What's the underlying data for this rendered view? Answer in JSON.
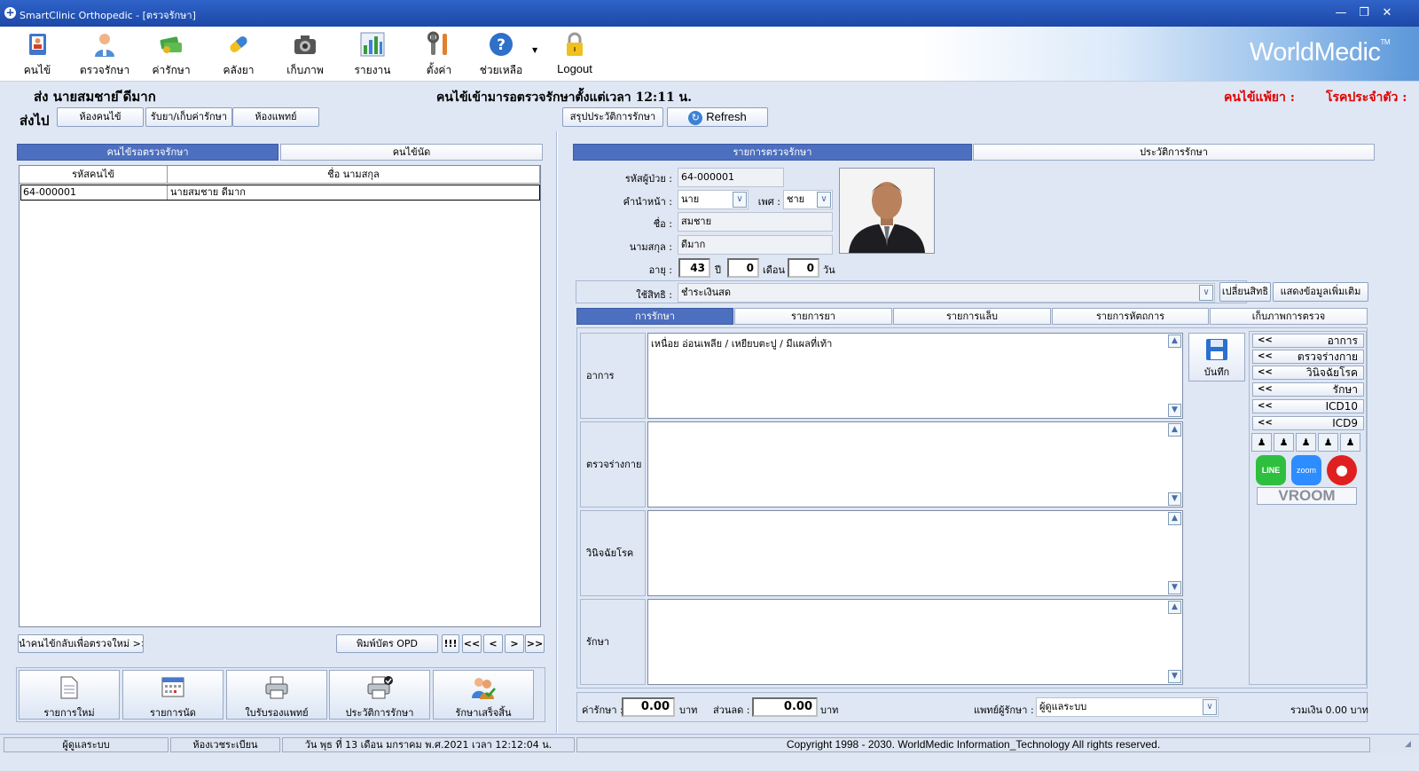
{
  "window": {
    "title": "SmartClinic Orthopedic - [ตรวจรักษา]"
  },
  "toolbar": {
    "items": [
      {
        "label": "คนไข้",
        "icon": "patient-book-icon"
      },
      {
        "label": "ตรวจรักษา",
        "icon": "doctor-icon"
      },
      {
        "label": "ค่ารักษา",
        "icon": "money-icon"
      },
      {
        "label": "คลังยา",
        "icon": "capsule-icon"
      },
      {
        "label": "เก็บภาพ",
        "icon": "camera-icon"
      },
      {
        "label": "รายงาน",
        "icon": "bar-chart-icon"
      },
      {
        "label": "ตั้งค่า",
        "icon": "tools-icon"
      },
      {
        "label": "ช่วยเหลือ",
        "icon": "help-icon"
      },
      {
        "label": "Logout",
        "icon": "lock-icon"
      }
    ],
    "brand": "WorldMedic",
    "brand_tm": "TM"
  },
  "header": {
    "send_name": "ส่ง  นายสมชาย ีดีมาก",
    "wait_message": "คนไข้เข้ามารอตรวจรักษาตั้งแต่เวลา 12:11 น.",
    "allergy_label": "คนไข้แพ้ยา :",
    "chronic_label": "โรคประจำตัว :"
  },
  "sendto": {
    "label": "ส่งไป",
    "buttons": [
      "ห้องคนไข้",
      "รับยา/เก็บค่ารักษา",
      "ห้องแพทย์"
    ],
    "summary_button": "สรุปประวัติการรักษา",
    "refresh_button": "Refresh"
  },
  "left": {
    "tabs": [
      "คนไข้รอตรวจรักษา",
      "คนไข้นัด"
    ],
    "columns": [
      "รหัสคนไข้",
      "ชื่อ นามสกุล"
    ],
    "rows": [
      {
        "id": "64-000001",
        "name": "นายสมชาย ดีมาก"
      }
    ],
    "return_button": "นำคนไข้กลับเพื่อตรวจใหม่ >>",
    "print_button": "พิมพ์บัตร OPD",
    "nav": [
      "!!!",
      "<<",
      "<",
      ">",
      ">>"
    ],
    "big_buttons": [
      {
        "label": "รายการใหม่",
        "icon": "document-icon"
      },
      {
        "label": "รายการนัด",
        "icon": "calendar-icon"
      },
      {
        "label": "ใบรับรองแพทย์",
        "icon": "printer-icon"
      },
      {
        "label": "ประวัติการรักษา",
        "icon": "printer-check-icon"
      },
      {
        "label": "รักษาเสร็จสิ้น",
        "icon": "users-check-icon"
      }
    ]
  },
  "right": {
    "tabs": [
      "รายการตรวจรักษา",
      "ประวัติการรักษา"
    ],
    "patient": {
      "id_label": "รหัสผู้ป่วย :",
      "id": "64-000001",
      "prefix_label": "คำนำหน้า :",
      "prefix": "นาย",
      "sex_label": "เพศ :",
      "sex": "ชาย",
      "first_label": "ชื่อ :",
      "first": "สมชาย",
      "last_label": "นามสกุล :",
      "last": "ดีมาก",
      "age_label": "อายุ :",
      "age_years": "43",
      "years_unit": "ปี",
      "age_months": "0",
      "months_unit": "เดือน",
      "age_days": "0",
      "days_unit": "วัน"
    },
    "rights_label": "ใช้สิทธิ :",
    "rights": "ชำระเงินสด",
    "change_rights_button": "เปลี่ยนสิทธิ",
    "more_info_button": "แสดงข้อมูลเพิ่มเติม",
    "sub_tabs": [
      "การรักษา",
      "รายการยา",
      "รายการแล็บ",
      "รายการหัตถการ",
      "เก็บภาพการตรวจ"
    ],
    "sections": [
      {
        "label": "อาการ",
        "text": "เหนื่อย อ่อนเพลีย / เหยียบตะปู / มีแผลที่เท้า"
      },
      {
        "label": "ตรวจร่างกาย",
        "text": ""
      },
      {
        "label": "วินิจฉัยโรค",
        "text": ""
      },
      {
        "label": "รักษา",
        "text": ""
      }
    ],
    "save_label": "บันทึก",
    "side_items": [
      "อาการ",
      "ตรวจร่างกาย",
      "วินิจฉัยโรค",
      "รักษา",
      "ICD10",
      "ICD9"
    ],
    "side_arrow": "<<",
    "apps": {
      "line": "LINE",
      "zoom": "zoom",
      "vroom": "VROOM"
    },
    "fee_label": "ค่ารักษา :",
    "fee": "0.00",
    "fee_unit": "บาท",
    "discount_label": "ส่วนลด :",
    "discount": "0.00",
    "discount_unit": "บาท",
    "doctor_label": "แพทย์ผู้รักษา :",
    "doctor": "ผู้ดูแลระบบ",
    "total": "รวมเงิน 0.00 บาท"
  },
  "status": {
    "user": "ผู้ดูแลระบบ",
    "room": "ห้องเวชระเบียน",
    "datetime": "วัน พุธ ที่ 13 เดือน มกราคม พ.ศ.2021 เวลา 12:12:04 น.",
    "copyright": "Copyright 1998 - 2030. WorldMedic Information_Technology All rights reserved."
  },
  "colors": {
    "accent": "#4d6fc0",
    "title_bar": "#1c48a8",
    "alert": "#e00000"
  }
}
